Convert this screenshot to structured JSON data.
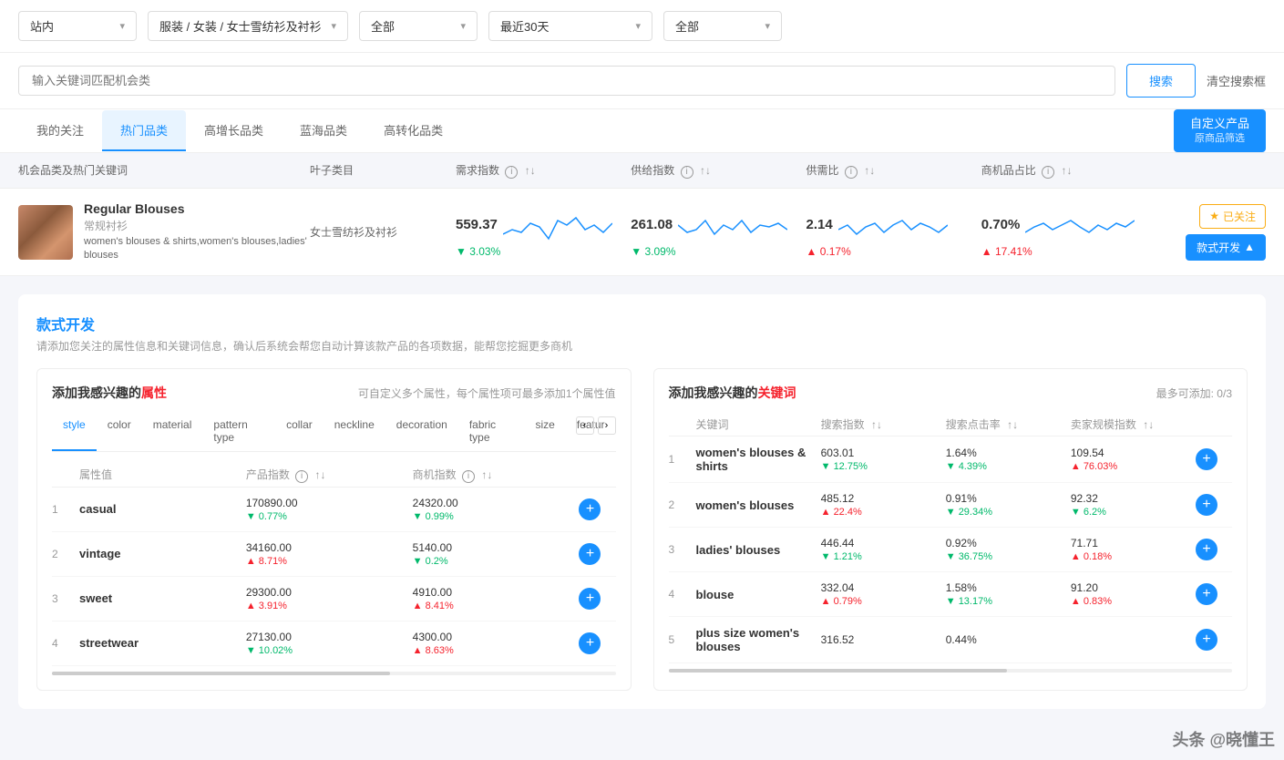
{
  "filters": {
    "site": "站内",
    "category": "服装 / 女装 / 女士雪纺衫及衬衫",
    "scope": "全部",
    "period": "最近30天",
    "extra": "全部",
    "chevron": "▾"
  },
  "search": {
    "placeholder": "输入关键词匹配机会类",
    "btn_search": "搜索",
    "btn_clear": "清空搜索框"
  },
  "tabs": [
    {
      "id": "my-follow",
      "label": "我的关注",
      "active": false
    },
    {
      "id": "hot-category",
      "label": "热门品类",
      "active": true
    },
    {
      "id": "high-growth",
      "label": "高增长品类",
      "active": false
    },
    {
      "id": "blue-ocean",
      "label": "蓝海品类",
      "active": false
    },
    {
      "id": "high-conversion",
      "label": "高转化品类",
      "active": false
    }
  ],
  "btn_custom": "自定义产品",
  "btn_custom_sub": "原商品筛选",
  "table_header": {
    "col1": "机会品类及热门关键词",
    "col2": "叶子类目",
    "col3": "需求指数",
    "col4": "供给指数",
    "col5": "供需比",
    "col6": "商机品占比"
  },
  "product": {
    "title": "Regular Blouses",
    "subtitle": "常规衬衫",
    "keywords": "women's blouses & shirts,women's blouses,ladies' blouses",
    "leaf_category": "女士雪纺衫及衬衫",
    "demand_index": "559.37",
    "demand_change": "▼ 3.03%",
    "demand_down": true,
    "supply_index": "261.08",
    "supply_change": "▼ 3.09%",
    "supply_down": true,
    "supply_ratio": "2.14",
    "ratio_change": "▲ 0.17%",
    "ratio_up": true,
    "merchant_ratio": "0.70%",
    "merchant_change": "▲ 17.41%",
    "merchant_up": true,
    "follow_label": "已关注",
    "develop_label": "款式开发",
    "develop_arrow": "▲"
  },
  "develop_section": {
    "title": "款式开发",
    "title_highlight": "款式开发",
    "desc": "请添加您关注的属性信息和关键词信息，确认后系统会帮您自动计算该款产品的各项数据，能帮您挖掘更多商机",
    "attr_panel_title": "添加我感兴趣的",
    "attr_panel_highlight": "属性",
    "attr_panel_subtitle": "可自定义多个属性，每个属性项可最多添加1个属性值",
    "kw_panel_title": "添加我感兴趣的",
    "kw_panel_highlight": "关键词",
    "kw_panel_max": "最多可添加: 0/3",
    "attr_tabs": [
      "style",
      "color",
      "material",
      "pattern type",
      "collar",
      "neckline",
      "decoration",
      "fabric type",
      "size",
      "featur"
    ],
    "attr_active_tab": "style",
    "attr_col_headers": [
      "",
      "属性值",
      "产品指数",
      "商机指数",
      ""
    ],
    "attr_rows": [
      {
        "num": "1",
        "name": "casual",
        "prod_idx": "170890.00",
        "prod_change": "▼ 0.77%",
        "prod_down": true,
        "merch_idx": "24320.00",
        "merch_change": "▼ 0.99%",
        "merch_down": true
      },
      {
        "num": "2",
        "name": "vintage",
        "prod_idx": "34160.00",
        "prod_change": "▲ 8.71%",
        "prod_down": false,
        "merch_idx": "5140.00",
        "merch_change": "▼ 0.2%",
        "merch_down": true
      },
      {
        "num": "3",
        "name": "sweet",
        "prod_idx": "29300.00",
        "prod_change": "▲ 3.91%",
        "prod_down": false,
        "merch_idx": "4910.00",
        "merch_change": "▲ 8.41%",
        "merch_down": false
      },
      {
        "num": "4",
        "name": "streetwear",
        "prod_idx": "27130.00",
        "prod_change": "▼ 10.02%",
        "prod_down": true,
        "merch_idx": "4300.00",
        "merch_change": "▲ 8.63%",
        "merch_down": false
      }
    ],
    "kw_col_headers": [
      "",
      "关键词",
      "搜索指数",
      "搜索点击率",
      "卖家规模指数",
      ""
    ],
    "kw_rows": [
      {
        "num": "1",
        "name": "women's blouses & shirts",
        "search_idx": "603.01",
        "search_change": "▼ 12.75%",
        "search_down": true,
        "click_rate": "1.64%",
        "click_change": "▼ 4.39%",
        "click_down": true,
        "seller_idx": "109.54",
        "seller_change": "▲ 76.03%",
        "seller_up": true
      },
      {
        "num": "2",
        "name": "women's blouses",
        "search_idx": "485.12",
        "search_change": "▲ 22.4%",
        "search_down": false,
        "click_rate": "0.91%",
        "click_change": "▼ 29.34%",
        "click_down": true,
        "seller_idx": "92.32",
        "seller_change": "▼ 6.2%",
        "seller_up": false
      },
      {
        "num": "3",
        "name": "ladies' blouses",
        "search_idx": "446.44",
        "search_change": "▼ 1.21%",
        "search_down": true,
        "click_rate": "0.92%",
        "click_change": "▼ 36.75%",
        "click_down": true,
        "seller_idx": "71.71",
        "seller_change": "▲ 0.18%",
        "seller_up": true
      },
      {
        "num": "4",
        "name": "blouse",
        "search_idx": "332.04",
        "search_change": "▲ 0.79%",
        "search_down": false,
        "click_rate": "1.58%",
        "click_change": "▼ 13.17%",
        "click_down": true,
        "seller_idx": "91.20",
        "seller_change": "▲ 0.83%",
        "seller_up": true
      },
      {
        "num": "5",
        "name": "plus size women's blouses",
        "search_idx": "316.52",
        "search_change": "",
        "search_down": false,
        "click_rate": "0.44%",
        "click_change": "",
        "click_down": false,
        "seller_idx": "",
        "seller_change": "",
        "seller_up": false
      }
    ]
  },
  "watermark": "头条 @晓懂王"
}
